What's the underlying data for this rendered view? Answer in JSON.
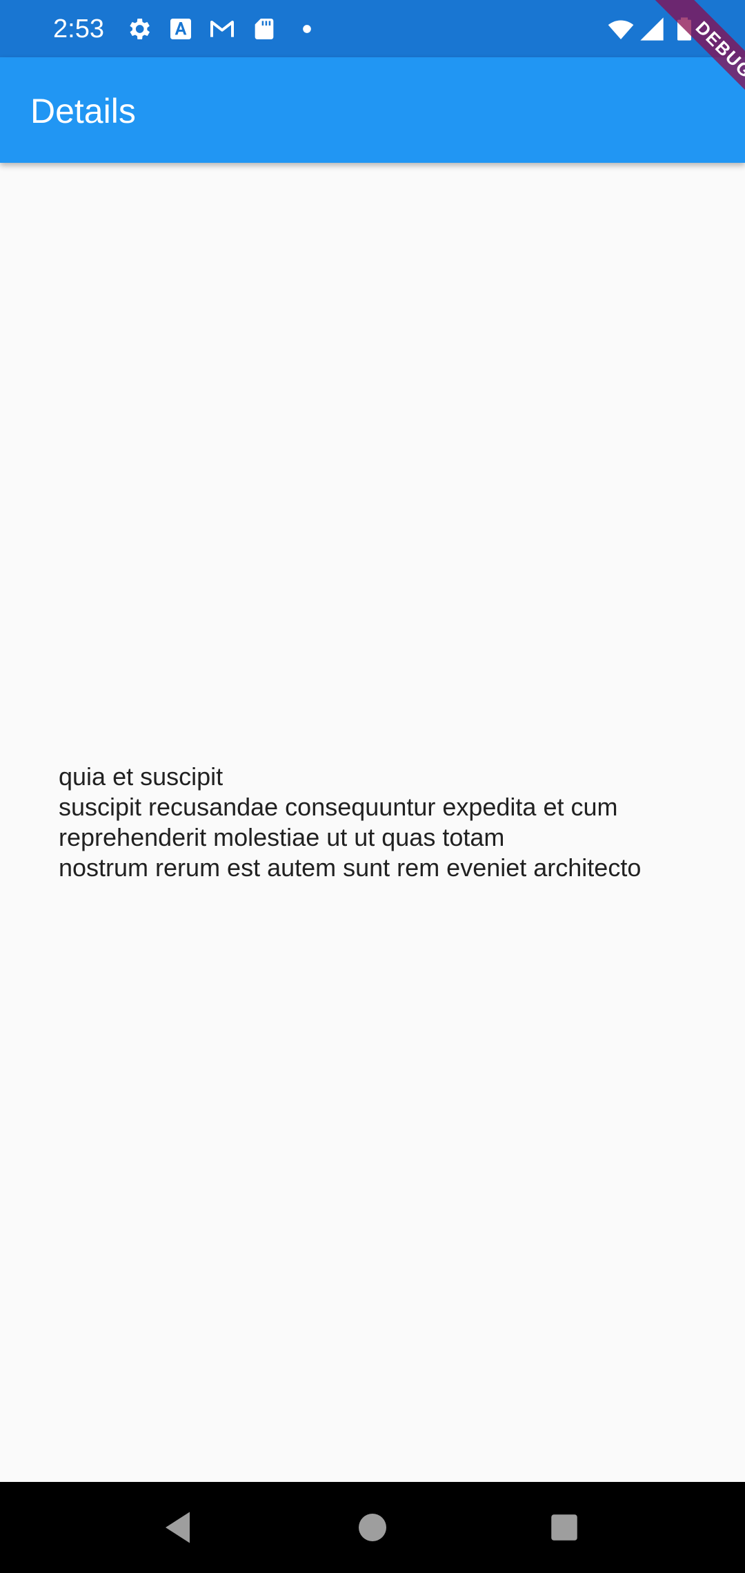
{
  "status_bar": {
    "time": "2:53",
    "left_icons": [
      "gear-icon",
      "font-a-icon",
      "gmail-icon",
      "sd-card-icon",
      "dot-icon"
    ],
    "right_icons": [
      "wifi-icon",
      "signal-icon",
      "battery-icon"
    ]
  },
  "app_bar": {
    "title": "Details"
  },
  "debug_banner": {
    "label": "DEBUG"
  },
  "content": {
    "text": "quia et suscipit\nsuscipit recusandae consequuntur expedita et cum\nreprehenderit molestiae ut ut quas totam\nnostrum rerum est autem sunt rem eveniet architecto"
  },
  "nav_bar": {
    "buttons": [
      "back-icon",
      "home-icon",
      "recents-icon"
    ]
  },
  "colors": {
    "status_bar": "#1976d2",
    "app_bar": "#2196f3",
    "background": "#fafafa",
    "nav_bar": "#000000",
    "debug_ribbon": "#880e4f"
  }
}
